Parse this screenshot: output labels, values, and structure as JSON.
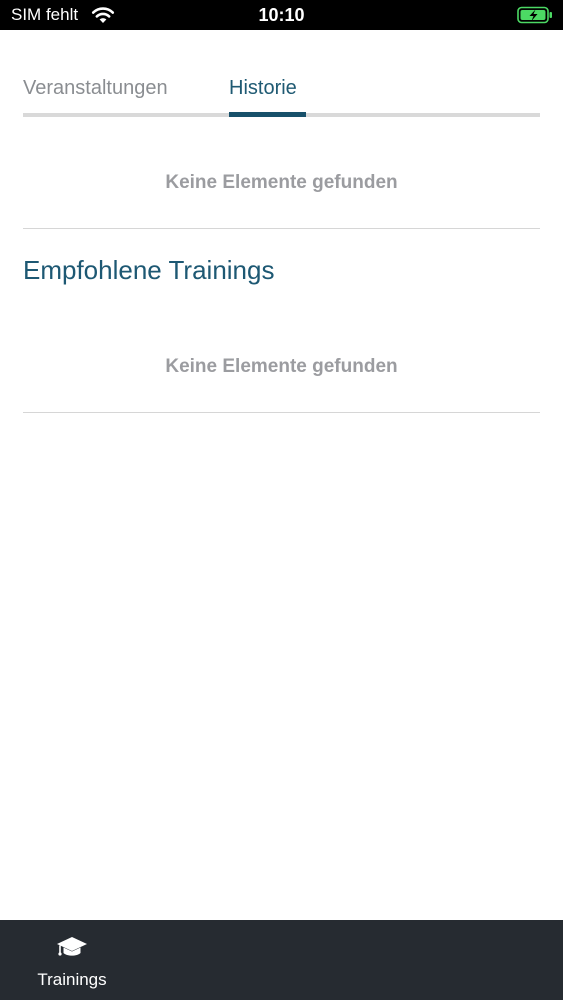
{
  "status_bar": {
    "carrier": "SIM fehlt",
    "time": "10:10",
    "battery_color": "#4cd964"
  },
  "tabs": [
    {
      "label": "Veranstaltungen",
      "active": false
    },
    {
      "label": "Historie",
      "active": true
    }
  ],
  "history": {
    "empty_message": "Keine Elemente gefunden"
  },
  "recommended": {
    "title": "Empfohlene Trainings",
    "empty_message": "Keine Elemente gefunden"
  },
  "bottom_nav": {
    "items": [
      {
        "label": "Trainings",
        "icon": "graduation-cap-icon"
      }
    ]
  },
  "colors": {
    "accent": "#17506a",
    "muted_text": "#9b9ca0",
    "nav_background": "#262b31"
  }
}
